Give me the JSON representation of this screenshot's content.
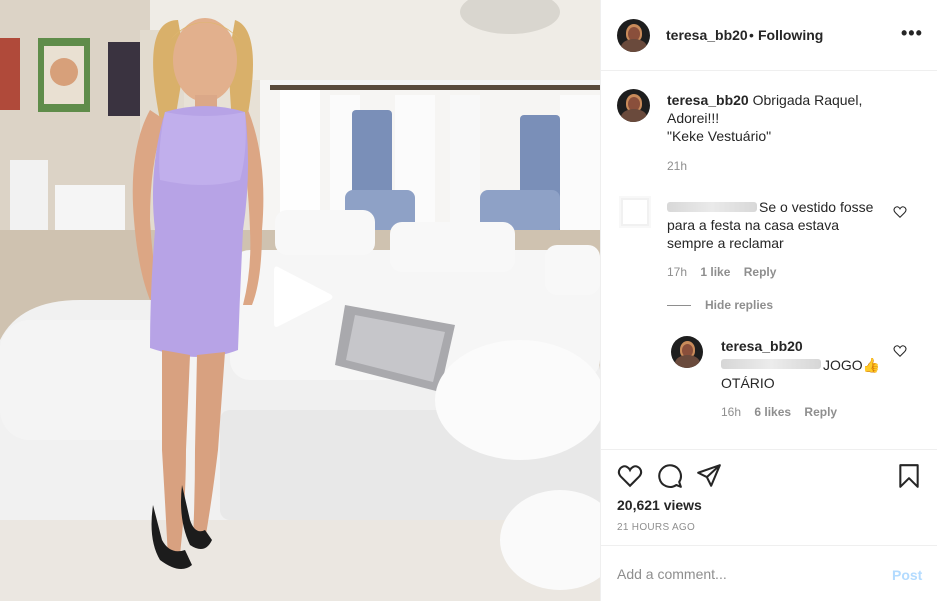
{
  "post": {
    "username": "teresa_bb20",
    "separator": "•",
    "follow_status": "Following",
    "more_icon": "more-horizontal-icon",
    "play_icon": "play-icon"
  },
  "caption": {
    "username": "teresa_bb20",
    "text": "Obrigada Raquel, Adorei!!!\n\"Keke Vestuário\"",
    "time": "21h"
  },
  "comments": [
    {
      "username_redacted": true,
      "text": "Se o vestido fosse para a festa na casa estava sempre a reclamar",
      "time": "17h",
      "likes": "1 like",
      "reply_label": "Reply"
    }
  ],
  "hide_replies_label": "Hide replies",
  "replies": [
    {
      "username": "teresa_bb20",
      "mention_redacted": true,
      "text": "JOGO👍 OTÁRIO",
      "time": "16h",
      "likes": "6 likes",
      "reply_label": "Reply"
    }
  ],
  "actions": {
    "like_icon": "heart-icon",
    "comment_icon": "comment-icon",
    "share_icon": "share-icon",
    "save_icon": "bookmark-icon"
  },
  "views": "20,621 views",
  "posted_ago": "21 HOURS AGO",
  "add_comment": {
    "placeholder": "Add a comment...",
    "post_label": "Post"
  },
  "colors": {
    "text": "#262626",
    "secondary": "#8e8e8e",
    "border": "#efefef",
    "post_disabled": "#b3dbff"
  }
}
